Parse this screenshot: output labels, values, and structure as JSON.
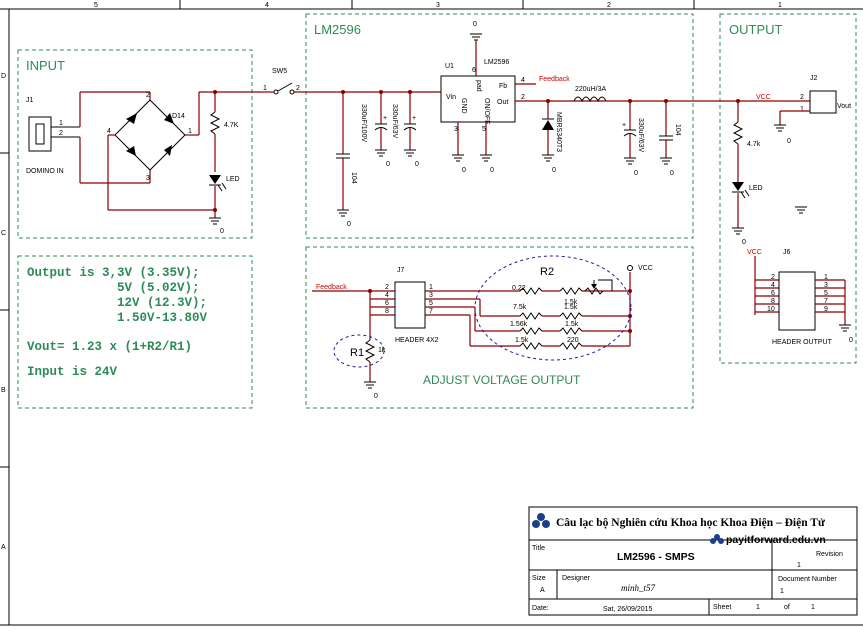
{
  "border": {
    "top_zones": [
      "5",
      "4",
      "3",
      "2",
      "1"
    ],
    "left_zones": [
      "D",
      "C",
      "B",
      "A"
    ]
  },
  "blocks": {
    "input": "INPUT",
    "lm2596": "LM2596",
    "output": "OUTPUT",
    "adjust": "ADJUST VOLTAGE OUTPUT"
  },
  "notes": {
    "line1": "Output is 3,3V (3.35V);",
    "line2": "5V (5.02V);",
    "line3": "12V (12.3V);",
    "line4": "1.50V-13.80V",
    "line5": "Vout= 1.23 x (1+R2/R1)",
    "line6": "Input is 24V"
  },
  "parts": {
    "j1_ref": "J1",
    "j1_name": "DOMINO IN",
    "d14": "D14",
    "r_in": "4.7K",
    "led": "LED",
    "sw5": "SW5",
    "c_in1": "330uF/100V",
    "c_in2": "330uF/63V",
    "c_in3": "104",
    "u1_ref": "U1",
    "u1_name": "LM2596",
    "u1_vin": "Vin",
    "u1_gnd": "GND",
    "u1_onoff": "ON/OFF",
    "u1_pad": "pad",
    "u1_fb": "Fb",
    "u1_out": "Out",
    "feedback": "Feedback",
    "inductor": "220uH/3A",
    "diode": "MBRS340T3",
    "c_out1": "330uF/63V",
    "c_out2": "104",
    "vcc": "VCC",
    "j2_ref": "J2",
    "j2_pin": "Vout",
    "r_out": "4.7k",
    "j7_ref": "J7",
    "j7_name": "HEADER 4X2",
    "r2_ref": "R2",
    "r1_ref": "R1",
    "r1_val": "1k",
    "res_a1": "0.22",
    "res_b1": "1.5k",
    "res_c1": "2.4k",
    "res_a2": "7.5k",
    "res_b2": "1.5k",
    "res_a3": "1.56k",
    "res_b3": "1.5k",
    "res_a4": "1.5k",
    "res_b4": "220",
    "j6_ref": "J6",
    "j6_name": "HEADER OUTPUT",
    "zero": "0"
  },
  "title_block": {
    "org": "Câu lạc bộ Nghiên cứu Khoa học Khoa Điện – Điện Tử",
    "site": "payitforward.edu.vn",
    "title_label": "Title",
    "title": "LM2596 - SMPS",
    "revision_label": "Revision",
    "revision": "1",
    "size_label": "Size",
    "size": "A",
    "designer_label": "Designer",
    "designer": "minh_t57",
    "docnum_label": "Document Number",
    "docnum": "1",
    "date_label": "Date:",
    "date": "Sat, 26/09/2015",
    "sheet_label": "Sheet",
    "sheet": "1",
    "of_label": "of",
    "sheets": "1"
  },
  "colors": {
    "wire": "#8b0000",
    "block_border": "#2e8b57",
    "net_label": "#cc0000",
    "adjust_outline": "#1c1c9c"
  }
}
